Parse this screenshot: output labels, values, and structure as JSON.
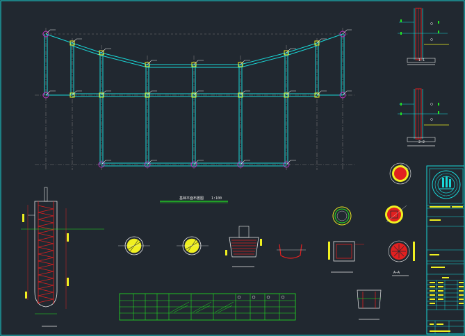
{
  "drawing": {
    "background": "#212830",
    "accent_cyan": "#19d8d8",
    "accent_green": "#22e622",
    "accent_red": "#e02020",
    "accent_yellow": "#f0f020",
    "accent_magenta": "#c030c0"
  },
  "plan": {
    "title": "基础平面布置图",
    "scale": "1:100"
  },
  "sections": [
    {
      "label": "1—1"
    },
    {
      "label": "2—2"
    }
  ],
  "details": {
    "round_column_section": "A—A"
  },
  "title_block": {
    "logo_icon": "university-seal-icon"
  }
}
